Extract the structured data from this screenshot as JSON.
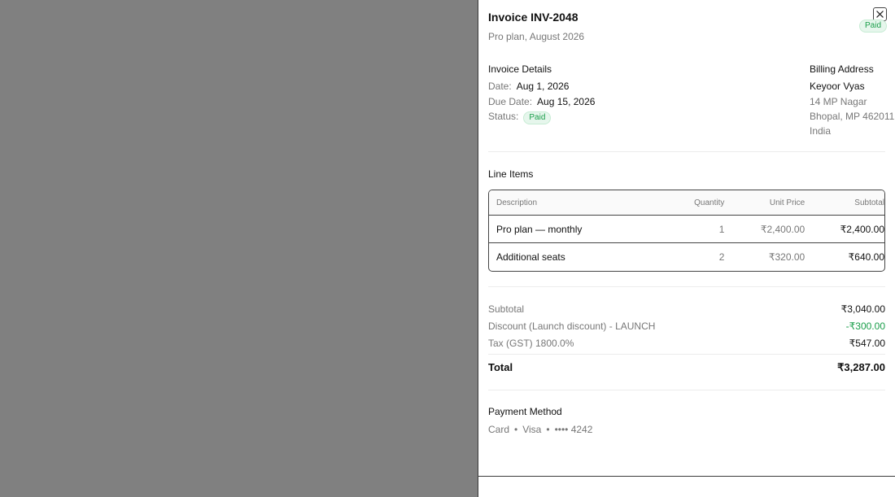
{
  "header": {
    "title": "Invoice INV-2048",
    "subtitle": "Pro plan, August 2026",
    "status_badge": "Paid"
  },
  "details": {
    "heading": "Invoice Details",
    "date_label": "Date:",
    "date_value": "Aug 1, 2026",
    "due_label": "Due Date:",
    "due_value": "Aug 15, 2026",
    "status_label": "Status:",
    "status_value": "Paid"
  },
  "billing": {
    "heading": "Billing Address",
    "name": "Keyoor Vyas",
    "line1": "14 MP Nagar",
    "line2": "Bhopal, MP 462011",
    "country": "India"
  },
  "line_items": {
    "heading": "Line Items",
    "columns": [
      "Description",
      "Quantity",
      "Unit Price",
      "Subtotal"
    ],
    "rows": [
      {
        "description": "Pro plan — monthly",
        "quantity": "1",
        "unit_price": "₹2,400.00",
        "subtotal": "₹2,400.00"
      },
      {
        "description": "Additional seats",
        "quantity": "2",
        "unit_price": "₹320.00",
        "subtotal": "₹640.00"
      }
    ]
  },
  "summary": {
    "subtotal_label": "Subtotal",
    "subtotal_value": "₹3,040.00",
    "discount_label": "Discount (Launch discount) - LAUNCH",
    "discount_value": "-₹300.00",
    "tax_label": "Tax (GST) 1800.0%",
    "tax_value": "₹547.00",
    "total_label": "Total",
    "total_value": "₹3,287.00"
  },
  "payment": {
    "heading": "Payment Method",
    "type": "Card",
    "brand": "Visa",
    "masked_number": "•••• 4242"
  },
  "colors": {
    "overlay": "#808080",
    "accent_green": "#1a9e4a",
    "badge_bg": "#e6f6ec"
  },
  "icons": {
    "close": "close-icon"
  }
}
